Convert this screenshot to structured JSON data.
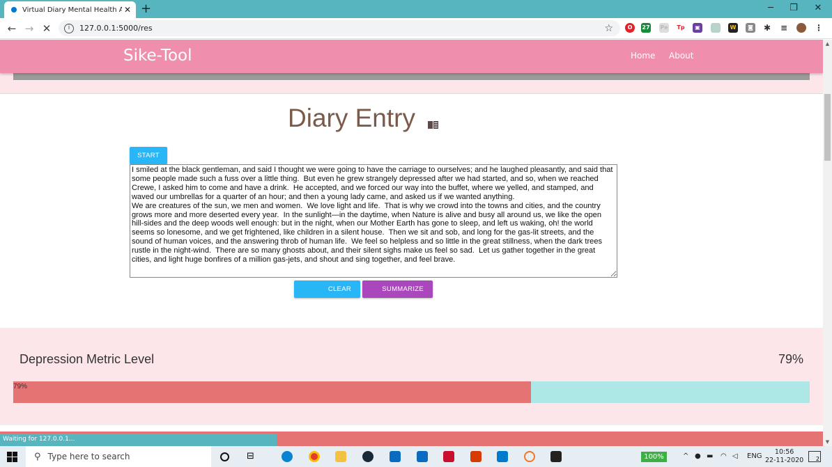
{
  "browser": {
    "tab_title": "Virtual Diary Mental Health Analy",
    "close_tab": "✕",
    "new_tab": "+",
    "url": "127.0.0.1:5000/res",
    "status": "Waiting for 127.0.0.1...",
    "window_controls": [
      "─",
      "❐",
      "✕"
    ],
    "extensions": [
      "opera-icon",
      "27-icon",
      "pe-icon",
      "tp-icon",
      "pocket-icon",
      "reader-icon",
      "wt-icon",
      "camera-icon",
      "puzzle-icon",
      "playlist-icon",
      "profile-icon",
      "menu-icon"
    ]
  },
  "navbar": {
    "brand": "Sike-Tool",
    "links": [
      "Home",
      "About"
    ]
  },
  "diary": {
    "title": "Diary Entry",
    "start_label": "START",
    "clear_label": "CLEAR",
    "summarize_label": "SUMMARIZE",
    "entry_text": "I smiled at the black gentleman, and said I thought we were going to have the carriage to ourselves; and he laughed pleasantly, and said that some people made such a fuss over a little thing.  But even he grew strangely depressed after we had started, and so, when we reached Crewe, I asked him to come and have a drink.  He accepted, and we forced our way into the buffet, where we yelled, and stamped, and waved our umbrellas for a quarter of an hour; and then a young lady came, and asked us if we wanted anything.\nWe are creatures of the sun, we men and women.  We love light and life.  That is why we crowd into the towns and cities, and the country grows more and more deserted every year.  In the sunlight—in the daytime, when Nature is alive and busy all around us, we like the open hill-sides and the deep woods well enough: but in the night, when our Mother Earth has gone to sleep, and left us waking, oh! the world seems so lonesome, and we get frightened, like children in a silent house.  Then we sit and sob, and long for the gas-lit streets, and the sound of human voices, and the answering throb of human life.  We feel so helpless and so little in the great stillness, when the dark trees rustle in the night-wind.  There are so many ghosts about, and their silent sighs make us feel so sad.  Let us gather together in the great cities, and light huge bonfires of a million gas-jets, and shout and sing together, and feel brave."
  },
  "metric": {
    "label": "Depression Metric Level",
    "percent_text": "79%",
    "bar_text": "79%",
    "level": 0.65,
    "fill_color": "#e57373",
    "track_color": "#aee8e6"
  },
  "taskbar": {
    "search_placeholder": "Type here to search",
    "battery": "100%",
    "language": "ENG",
    "time": "10:56",
    "date": "22-11-2020",
    "notifications": "2"
  },
  "colors": {
    "navbar": "#f08fad",
    "section_bg": "#fde6ea",
    "title": "#7a5a4a",
    "start": "#29b6f6",
    "summarize": "#ab47bc"
  }
}
